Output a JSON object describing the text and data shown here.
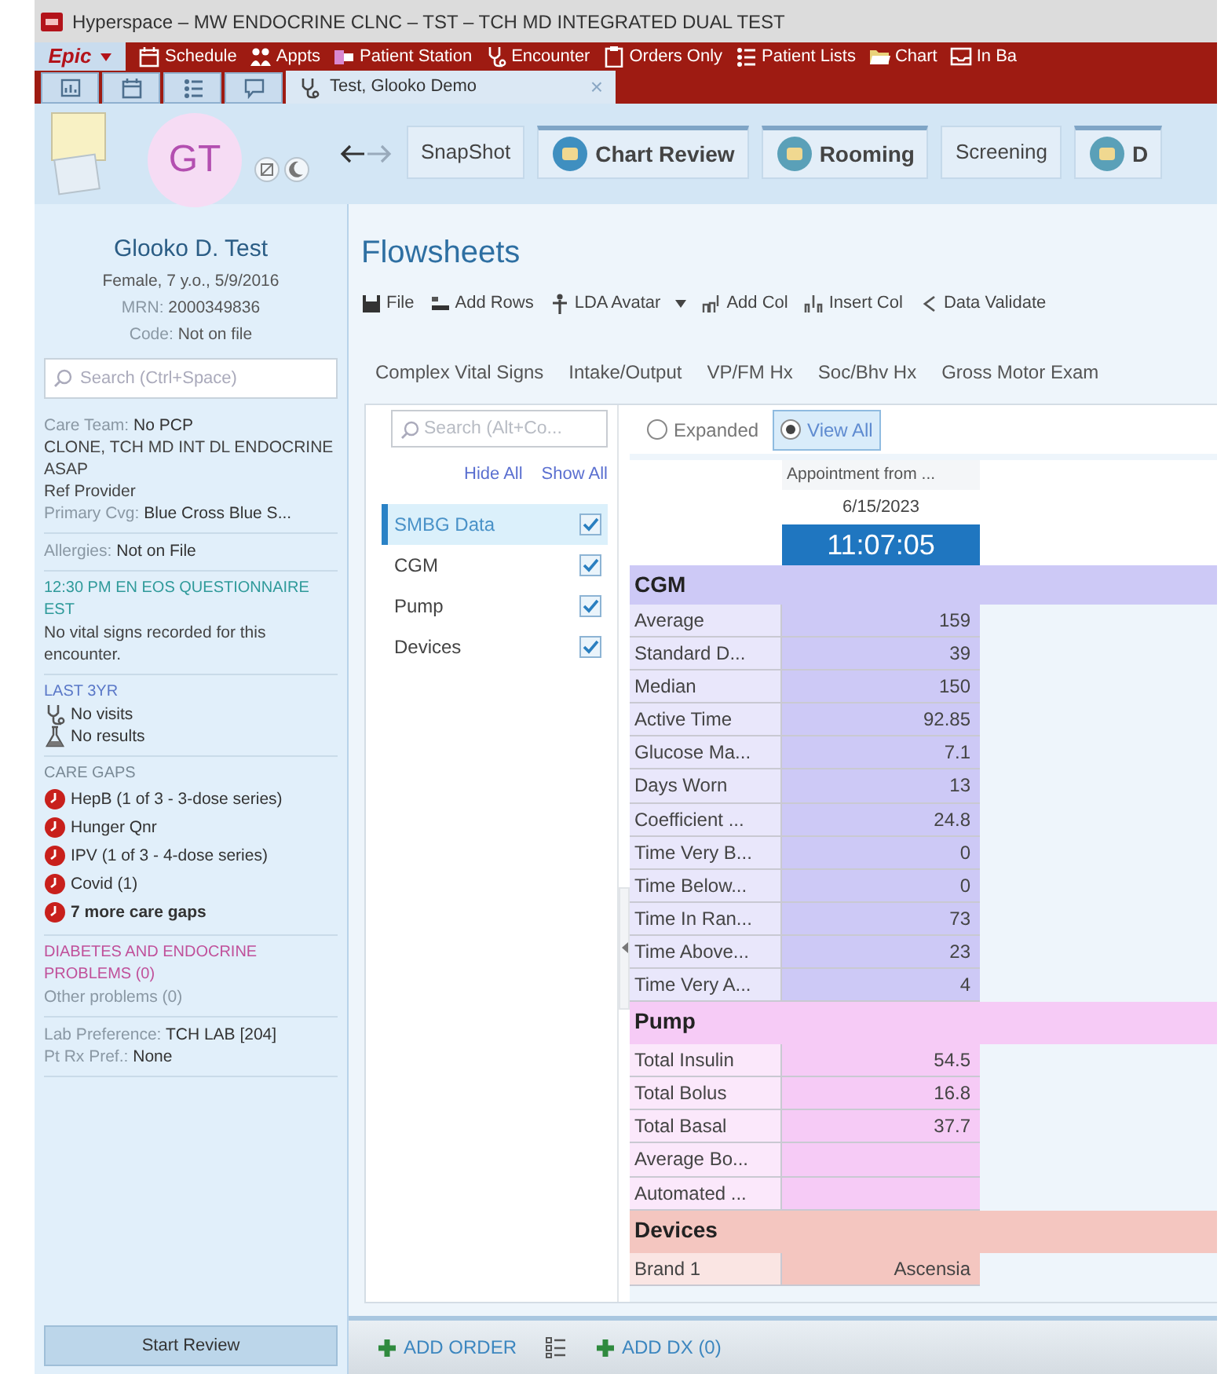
{
  "window": {
    "title": "Hyperspace – MW ENDOCRINE CLNC – TST – TCH MD INTEGRATED DUAL TEST"
  },
  "menu_bar": {
    "epic": "Epic",
    "items": [
      {
        "label": "Schedule",
        "kind": "calendar"
      },
      {
        "label": "Appts",
        "kind": "people"
      },
      {
        "label": "Patient Station",
        "kind": "station"
      },
      {
        "label": "Encounter",
        "kind": "stethoscope"
      },
      {
        "label": "Orders Only",
        "kind": "clipboard"
      },
      {
        "label": "Patient Lists",
        "kind": "list"
      },
      {
        "label": "Chart",
        "kind": "folder"
      },
      {
        "label": "In Ba",
        "kind": "inbox"
      }
    ]
  },
  "workspace_tabs": {
    "tools": [
      {
        "kind": "dashboard"
      },
      {
        "kind": "calendar"
      },
      {
        "kind": "list"
      },
      {
        "kind": "chat"
      }
    ],
    "patient_tab": {
      "label": "Test, Glooko Demo",
      "close": "×"
    }
  },
  "activity_tabs": [
    {
      "label": "SnapShot",
      "kind": "plain"
    },
    {
      "label": "Chart Review",
      "kind": "featured"
    },
    {
      "label": "Rooming",
      "kind": "featured"
    },
    {
      "label": "Screening",
      "kind": "plain"
    },
    {
      "label": "D",
      "kind": "featured"
    }
  ],
  "patient": {
    "initials": "GT",
    "name": "Glooko D. Test",
    "details": [
      {
        "value": "Female, 7 y.o., 5/9/2016"
      },
      {
        "label": "MRN:",
        "value": "2000349836"
      },
      {
        "label": "Code:",
        "value": "Not on file"
      }
    ]
  },
  "sidebar": {
    "search_placeholder": "Search (Ctrl+Space)",
    "sections": [
      {
        "lines": [
          {
            "kind": "text",
            "label": "Care Team:",
            "value": "No PCP"
          },
          {
            "kind": "text",
            "value": "CLONE, TCH MD INT DL ENDOCRINE ASAP"
          },
          {
            "kind": "text",
            "value": "Ref Provider"
          },
          {
            "kind": "text",
            "label": "Primary Cvg:",
            "value": "Blue Cross Blue S..."
          }
        ]
      },
      {
        "lines": [
          {
            "kind": "text",
            "label": "Allergies:",
            "value": "Not on File"
          }
        ]
      },
      {
        "heading": "12:30 PM EN EOS QUESTIONNAIRE EST",
        "color": "#2f9a9a",
        "lines": [
          {
            "kind": "text",
            "value": "No vital signs recorded for this encounter."
          }
        ]
      },
      {
        "heading": "LAST 3YR",
        "color": "#5a78c8",
        "lines": [
          {
            "kind": "visit",
            "value": "No visits"
          },
          {
            "kind": "lab",
            "value": "No results"
          }
        ]
      },
      {
        "heading": "CARE GAPS",
        "color": "#7a8a96",
        "lines": [
          {
            "kind": "gap",
            "value": "HepB (1 of 3 - 3-dose series)"
          },
          {
            "kind": "gap",
            "value": "Hunger Qnr"
          },
          {
            "kind": "gap",
            "value": "IPV (1 of 3 - 4-dose series)"
          },
          {
            "kind": "gap",
            "value": "Covid (1)"
          },
          {
            "kind": "gap",
            "value": "7 more care gaps",
            "bold": true
          }
        ]
      },
      {
        "heading": "DIABETES AND ENDOCRINE PROBLEMS (0)",
        "color": "#c0509a",
        "lines": [
          {
            "kind": "text",
            "label": "Other problems (0)"
          }
        ]
      },
      {
        "lines": [
          {
            "kind": "text",
            "label": "Lab Preference:",
            "value": "TCH LAB [204]"
          },
          {
            "kind": "text",
            "label": "Pt Rx Pref.:",
            "value": "None"
          }
        ]
      }
    ],
    "start_review": "Start Review"
  },
  "flowsheet": {
    "title": "Flowsheets",
    "toolbar": [
      {
        "label": "File",
        "kind": "save"
      },
      {
        "label": "Add Rows",
        "kind": "rows"
      },
      {
        "label": "LDA Avatar",
        "kind": "avatar",
        "dropdown": true
      },
      {
        "label": "Add Col",
        "kind": "addcol"
      },
      {
        "label": "Insert Col",
        "kind": "insertcol"
      },
      {
        "label": "Data Validate",
        "kind": "validate"
      }
    ],
    "tabs": [
      "Complex Vital Signs",
      "Intake/Output",
      "VP/FM Hx",
      "Soc/Bhv Hx",
      "Gross Motor Exam"
    ],
    "search_placeholder": "Search (Alt+Co...",
    "hide_all": "Hide All",
    "show_all": "Show All",
    "groups": [
      {
        "label": "SMBG Data",
        "checked": true,
        "selected": true
      },
      {
        "label": "CGM",
        "checked": true,
        "selected": false
      },
      {
        "label": "Pump",
        "checked": true,
        "selected": false
      },
      {
        "label": "Devices",
        "checked": true,
        "selected": false
      }
    ],
    "view_options": [
      {
        "label": "Expanded",
        "selected": false
      },
      {
        "label": "View All",
        "selected": true
      }
    ],
    "column": {
      "title": "Appointment from ...",
      "date": "6/15/2023",
      "time": "11:07:05"
    },
    "sections": [
      {
        "title": "CGM",
        "color": "#cdc9f6",
        "rows": [
          {
            "label": "Average",
            "value": "159"
          },
          {
            "label": "Standard D...",
            "value": "39"
          },
          {
            "label": "Median",
            "value": "150"
          },
          {
            "label": "Active Time",
            "value": "92.85"
          },
          {
            "label": "Glucose Ma...",
            "value": "7.1"
          },
          {
            "label": "Days Worn",
            "value": "13"
          },
          {
            "label": "Coefficient ...",
            "value": "24.8"
          },
          {
            "label": "Time Very B...",
            "value": "0"
          },
          {
            "label": "Time Below...",
            "value": "0"
          },
          {
            "label": "Time In Ran...",
            "value": "73"
          },
          {
            "label": "Time Above...",
            "value": "23"
          },
          {
            "label": "Time Very A...",
            "value": "4"
          }
        ]
      },
      {
        "title": "Pump",
        "color": "#f6cbf6",
        "rows": [
          {
            "label": "Total Insulin",
            "value": "54.5"
          },
          {
            "label": "Total Bolus",
            "value": "16.8"
          },
          {
            "label": "Total Basal",
            "value": "37.7"
          },
          {
            "label": "Average Bo..."
          },
          {
            "label": "Automated ..."
          }
        ]
      },
      {
        "title": "Devices",
        "color": "#f4c6c0",
        "rows": [
          {
            "label": "Brand 1",
            "value": "Ascensia"
          }
        ]
      }
    ]
  },
  "footer": [
    {
      "kind": "add",
      "label": "ADD ORDER"
    },
    {
      "kind": "list"
    },
    {
      "kind": "add",
      "label": "ADD DX (0)"
    }
  ]
}
